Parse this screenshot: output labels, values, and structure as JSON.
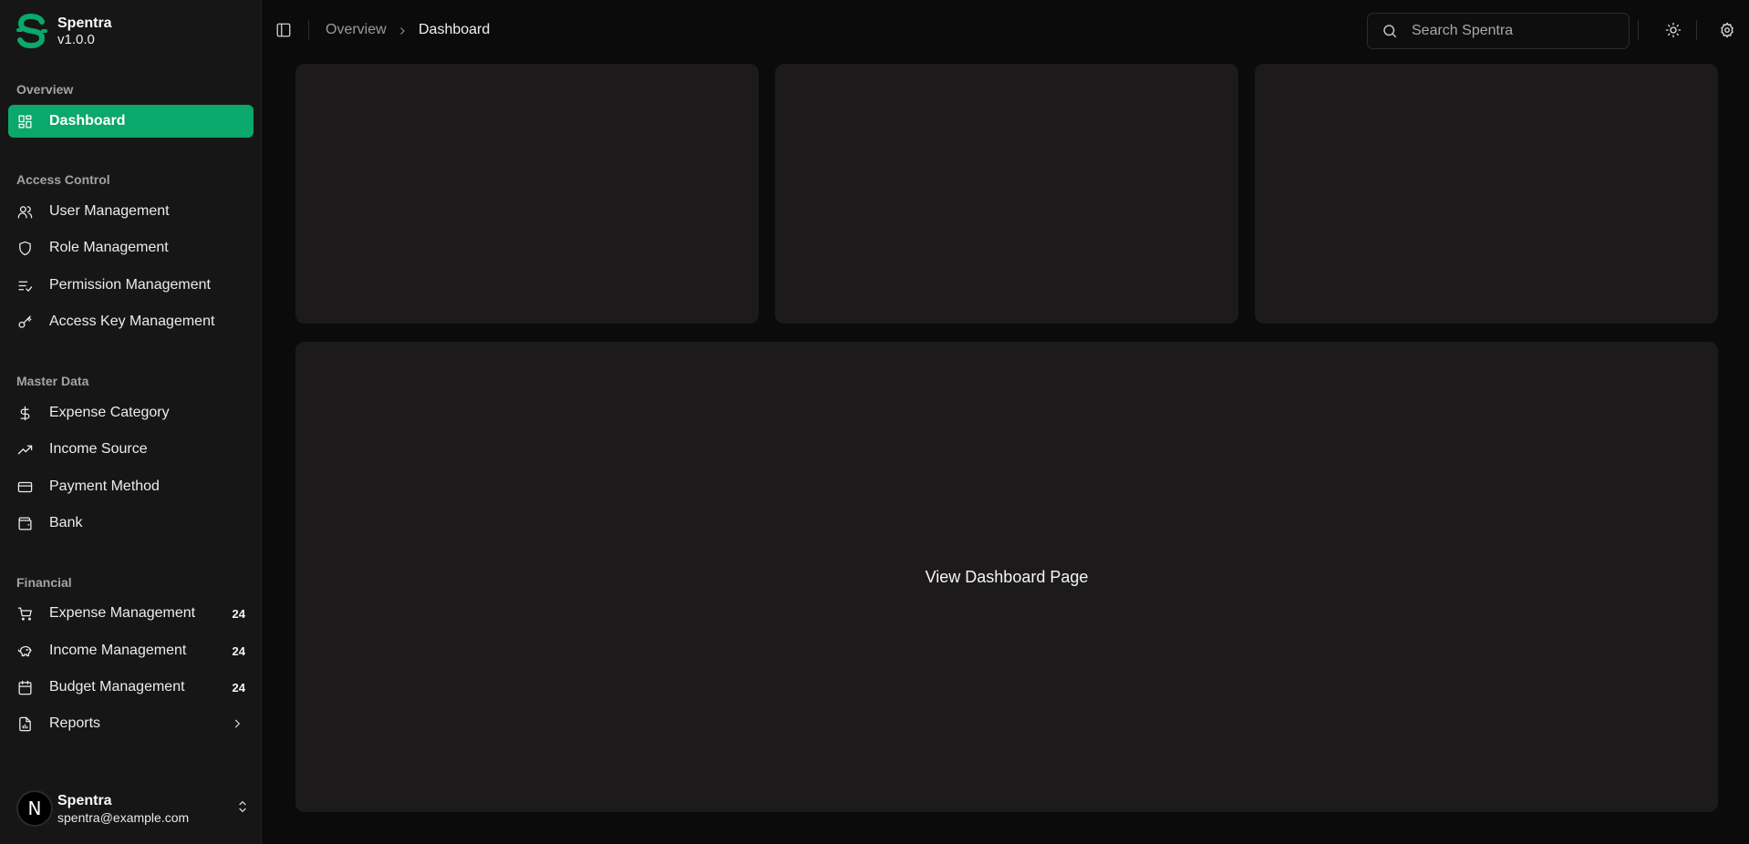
{
  "brand": {
    "name": "Spentra",
    "version": "v1.0.0",
    "accent": "#0aa86a"
  },
  "groups": {
    "overview": "Overview",
    "access": "Access Control",
    "master": "Master Data",
    "financial": "Financial"
  },
  "nav": {
    "dashboard": "Dashboard",
    "user_management": "User Management",
    "role_management": "Role Management",
    "permission_management": "Permission Management",
    "access_key_management": "Access Key Management",
    "expense_category": "Expense Category",
    "income_source": "Income Source",
    "payment_method": "Payment Method",
    "bank": "Bank",
    "expense_management": "Expense Management",
    "expense_management_badge": "24",
    "income_management": "Income Management",
    "income_management_badge": "24",
    "budget_management": "Budget Management",
    "budget_management_badge": "24",
    "reports": "Reports"
  },
  "user": {
    "initial": "N",
    "name": "Spentra",
    "email": "spentra@example.com"
  },
  "header": {
    "breadcrumb_parent": "Overview",
    "breadcrumb_current": "Dashboard",
    "search_placeholder": "Search Spentra"
  },
  "main": {
    "placeholder_text": "View Dashboard Page"
  }
}
